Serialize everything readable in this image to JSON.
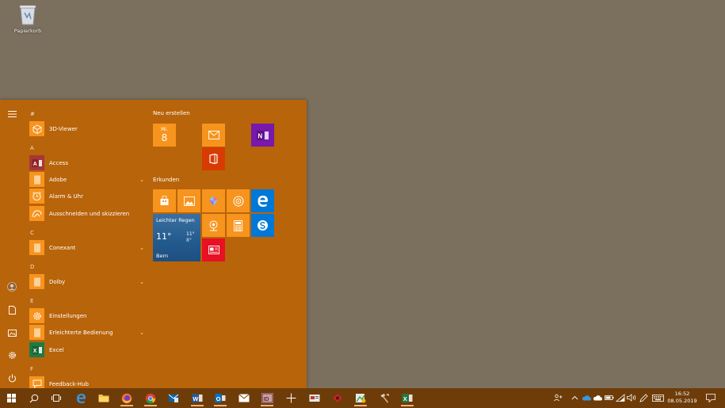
{
  "desktop": {
    "recycle_bin_label": "Papierkorb"
  },
  "applist": {
    "letters": [
      "#",
      "A",
      "C",
      "D",
      "E",
      "F"
    ],
    "apps": [
      {
        "name": "3D-Viewer",
        "icon": "cube-icon"
      },
      {
        "name": "Access",
        "icon": "access-icon"
      },
      {
        "name": "Adobe",
        "icon": "folder-icon",
        "expandable": true
      },
      {
        "name": "Alarm & Uhr",
        "icon": "alarm-clock-icon"
      },
      {
        "name": "Ausschneiden und skizzieren",
        "icon": "snip-sketch-icon"
      },
      {
        "name": "Conexant",
        "icon": "folder-icon",
        "expandable": true
      },
      {
        "name": "Dolby",
        "icon": "folder-icon",
        "expandable": true
      },
      {
        "name": "Einstellungen",
        "icon": "gear-icon"
      },
      {
        "name": "Erleichterte Bedienung",
        "icon": "folder-icon",
        "expandable": true
      },
      {
        "name": "Excel",
        "icon": "excel-icon"
      },
      {
        "name": "Feedback-Hub",
        "icon": "feedback-icon"
      }
    ],
    "expand_glyph": "⌄"
  },
  "tiles": {
    "group1_title": "Neu erstellen",
    "group2_title": "Erkunden",
    "calendar_day": "Mi.",
    "calendar_date": "8",
    "weather": {
      "condition": "Leichter Regen",
      "temp": "11°",
      "high": "11°",
      "low": "8°",
      "city": "Bern"
    }
  },
  "taskbar": {
    "time": "16:52",
    "date": "08.05.2019",
    "icons": [
      "windows-logo-icon",
      "search-icon",
      "task-view-icon",
      "edge-icon",
      "file-explorer-icon",
      "firefox-icon",
      "chrome-icon",
      "outlook-icon",
      "word-icon",
      "outlook-mail-icon",
      "mail-icon",
      "indesign-icon",
      "crosshair-icon",
      "app-icon",
      "red-app-icon",
      "green-app-icon",
      "tool-icon",
      "excel-icon"
    ]
  },
  "colors": {
    "start_bg": "#b8640a",
    "tile_orange": "#f7941d",
    "taskbar": "#6e3c08",
    "desktop": "#7b6f5d"
  }
}
